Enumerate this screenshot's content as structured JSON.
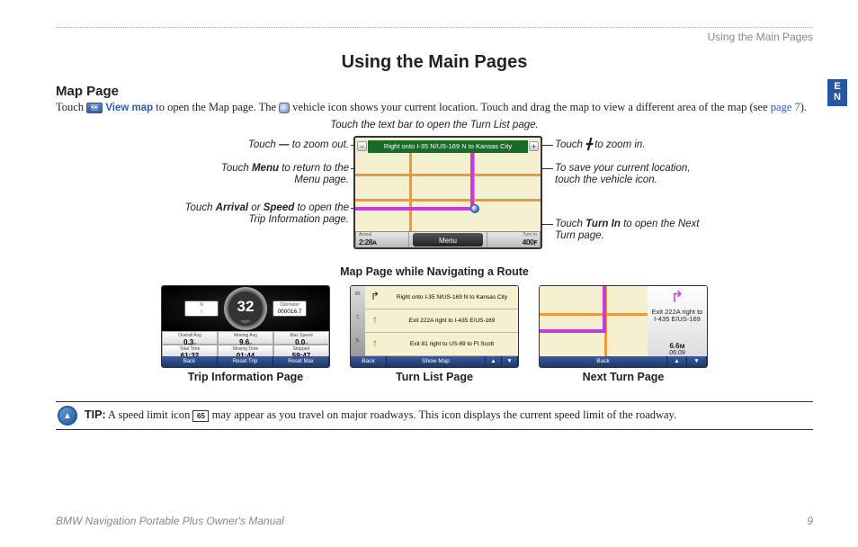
{
  "header": {
    "section": "Using the Main Pages",
    "title": "Using the Main Pages"
  },
  "lang_tab": "E\nN",
  "section": {
    "title": "Map Page",
    "touch": "Touch",
    "viewmap": "View map",
    "text1a": " to open the Map page. The ",
    "text1b": " vehicle icon shows your current location. Touch and drag the map to view a different area of the map (see ",
    "pagelink": "page 7",
    "text1c": ")."
  },
  "diagram": {
    "top": "Touch the text bar to open the Turn List page.",
    "textbar": "Right onto I-35 N/US-169 N to Kansas City",
    "arrival_lbl": "Arrival",
    "arrival_val": "2:28ᴀ",
    "turnin_lbl": "Turn In",
    "turnin_val": "400ꜰ",
    "menu": "Menu",
    "caption": "Map Page while Navigating a Route",
    "callouts": {
      "zoom_out_a": "Touch ",
      "zoom_out_b": " to zoom out.",
      "menu_a": "Touch ",
      "menu_kw": "Menu",
      "menu_b": " to return to the Menu page.",
      "speed_a": "Touch ",
      "speed_kw1": "Arrival",
      "speed_or": " or ",
      "speed_kw2": "Speed",
      "speed_b": " to open the Trip Information page.",
      "zoom_in_a": "Touch ",
      "zoom_in_b": " to zoom in.",
      "vehicle": "To save your current location, touch the vehicle icon.",
      "turnin_a": "Touch ",
      "turnin_kw": "Turn In",
      "turnin_b": " to open the Next Turn page."
    }
  },
  "thumbs": {
    "trip": {
      "caption": "Trip Information Page",
      "speed": "32",
      "odo_top": "N",
      "odo": "000016.7",
      "cells": [
        {
          "l": "Overall Avg",
          "v": "0.3",
          "u": "ᴍ"
        },
        {
          "l": "Moving Avg",
          "v": "9.6",
          "u": "ᴍ"
        },
        {
          "l": "Max Speed",
          "v": "0.0",
          "u": "ᴍ"
        },
        {
          "l": "Total Time",
          "v": "61:32",
          "u": ""
        },
        {
          "l": "Moving Time",
          "v": "01:44",
          "u": ""
        },
        {
          "l": "Stopped",
          "v": "59:47",
          "u": ""
        }
      ],
      "btns": [
        "Back",
        "Reset Trip",
        "Reset Max"
      ]
    },
    "turnlist": {
      "caption": "Turn List Page",
      "miles": [
        "20.",
        "7.",
        "5."
      ],
      "items": [
        {
          "a": "↱",
          "c": "",
          "t": "Right onto I-35 N/US-169 N to Kansas City"
        },
        {
          "a": "↑",
          "c": "green",
          "t": "Exit 222A right to I-435 E/US-169"
        },
        {
          "a": "↑",
          "c": "green",
          "t": "Exit 81 right to US-69 to Ft Scott"
        }
      ],
      "btns": [
        "Back",
        "Show Map"
      ]
    },
    "nextturn": {
      "caption": "Next Turn Page",
      "text": "Exit 222A right to I-435 E/US-169",
      "dist": "6.6ᴍ",
      "time": "06:09",
      "btns": [
        "Back",
        "▲",
        "▼"
      ]
    }
  },
  "tip": {
    "label": "TIP:",
    "speed": "65",
    "text_a": " A speed limit icon ",
    "text_b": " may appear as you travel on major roadways. This icon displays the current speed limit of the roadway."
  },
  "footer": {
    "left": "BMW Navigation Portable Plus Owner's Manual",
    "right": "9"
  }
}
